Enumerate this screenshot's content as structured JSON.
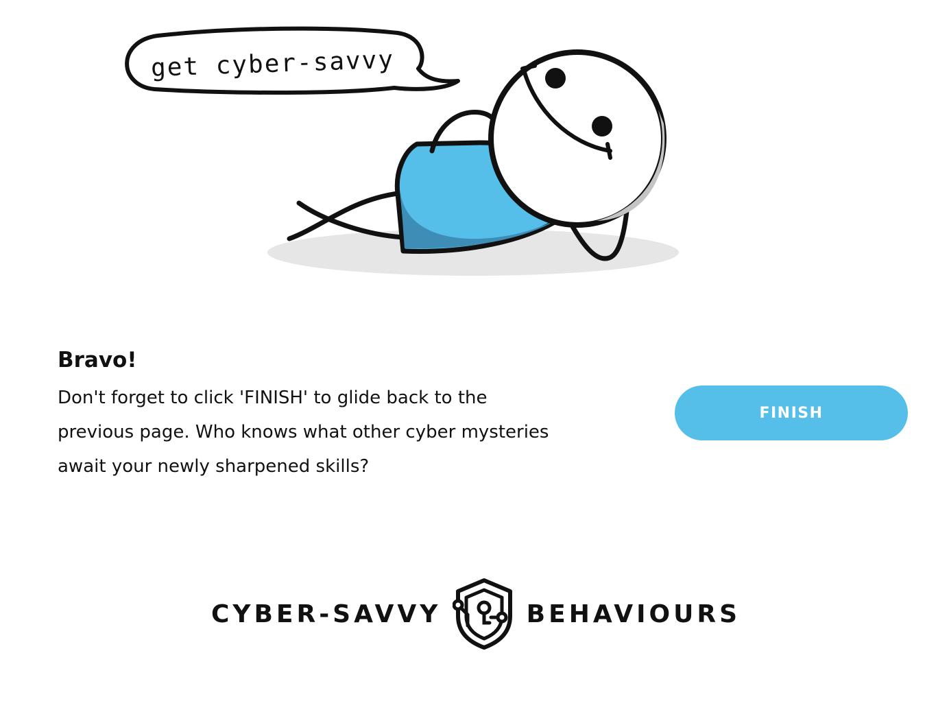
{
  "illustration": {
    "speech_bubble_text": "get cyber-savvy",
    "icon": "relaxing-stick-figure",
    "shirt_color": "#55bfea",
    "shadow_color": "#e6e6e6"
  },
  "message": {
    "title": "Bravo!",
    "body": "Don't forget to click 'FINISH' to glide back to the previous page. Who knows what other cyber mysteries await your newly sharpened skills?"
  },
  "finish_button": {
    "label": "FINISH",
    "color": "#55bfea"
  },
  "logo": {
    "left_word": "CYBER-SAVVY",
    "right_word": "BEHAVIOURS",
    "icon": "shield-circuit-icon"
  }
}
